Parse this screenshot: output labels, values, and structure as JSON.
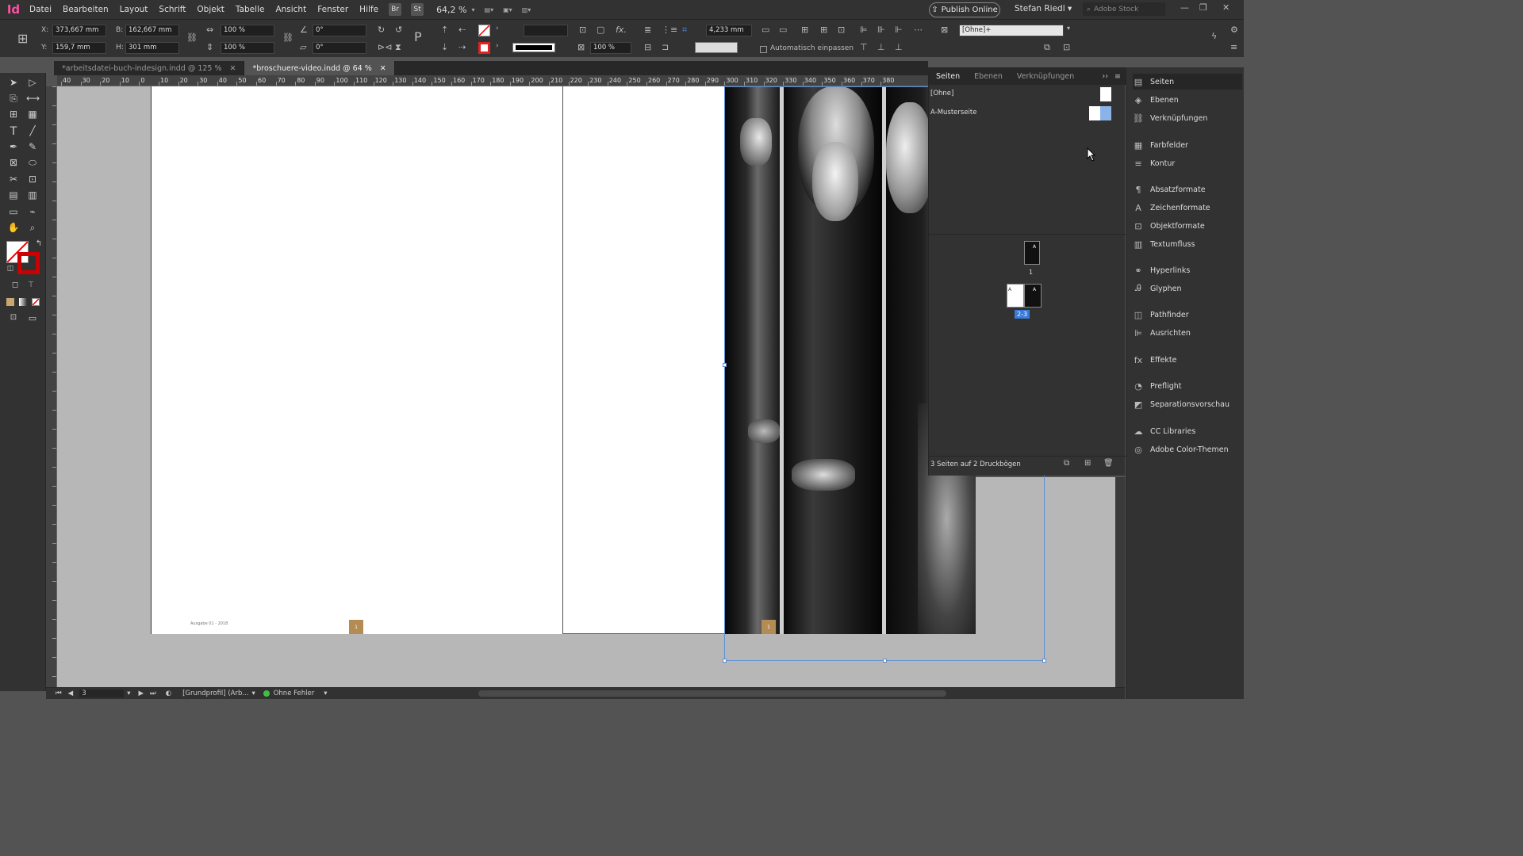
{
  "app": {
    "logo": "Id"
  },
  "menu": [
    "Datei",
    "Bearbeiten",
    "Layout",
    "Schrift",
    "Objekt",
    "Tabelle",
    "Ansicht",
    "Fenster",
    "Hilfe"
  ],
  "badges": {
    "bridge": "Br",
    "stock": "St"
  },
  "zoom": "64,2 %",
  "publish_label": "Publish Online",
  "user_name": "Stefan Riedl",
  "search_placeholder": "Adobe Stock",
  "control": {
    "x_label": "X:",
    "x_value": "373,667 mm",
    "y_label": "Y:",
    "y_value": "159,7 mm",
    "w_label": "B:",
    "w_value": "162,667 mm",
    "h_label": "H:",
    "h_value": "301 mm",
    "scale_x": "100 %",
    "scale_y": "100 %",
    "rotate": "0°",
    "shear": "0°",
    "stroke_weight": "4,233 mm",
    "opacity": "100 %",
    "object_style": "[Ohne]+",
    "autofit_label": "Automatisch einpassen"
  },
  "tabs": [
    {
      "label": "*arbeitsdatei-buch-indesign.indd @ 125 %"
    },
    {
      "label": "*broschuere-video.indd @ 64 %"
    }
  ],
  "ruler_ticks": [
    "40",
    "30",
    "20",
    "10",
    "0",
    "10",
    "20",
    "30",
    "40",
    "50",
    "60",
    "70",
    "80",
    "90",
    "100",
    "110",
    "120",
    "130",
    "140",
    "150",
    "160",
    "170",
    "180",
    "190",
    "200",
    "210",
    "220",
    "230",
    "240",
    "250",
    "260",
    "270",
    "280",
    "290",
    "300",
    "310",
    "320",
    "330",
    "340",
    "350",
    "360",
    "370",
    "380"
  ],
  "document": {
    "footer_text": "Ausgabe 01 - 2018",
    "page_number": "1"
  },
  "pages_panel": {
    "tabs": [
      "Seiten",
      "Ebenen",
      "Verknüpfungen"
    ],
    "none_label": "[Ohne]",
    "master_label": "A-Musterseite",
    "page1_label": "1",
    "spread_label": "2-3",
    "thumb_letter": "A",
    "summary": "3 Seiten auf 2 Druckbögen"
  },
  "right_panel": [
    {
      "label": "Seiten",
      "icon": "pages-icon"
    },
    {
      "label": "Ebenen",
      "icon": "layers-icon"
    },
    {
      "label": "Verknüpfungen",
      "icon": "links-icon"
    },
    {
      "label": "Farbfelder",
      "icon": "swatches-icon"
    },
    {
      "label": "Kontur",
      "icon": "stroke-icon"
    },
    {
      "label": "Absatzformate",
      "icon": "paragraph-styles-icon"
    },
    {
      "label": "Zeichenformate",
      "icon": "character-styles-icon"
    },
    {
      "label": "Objektformate",
      "icon": "object-styles-icon"
    },
    {
      "label": "Textumfluss",
      "icon": "text-wrap-icon"
    },
    {
      "label": "Hyperlinks",
      "icon": "hyperlinks-icon"
    },
    {
      "label": "Glyphen",
      "icon": "glyphs-icon"
    },
    {
      "label": "Pathfinder",
      "icon": "pathfinder-icon"
    },
    {
      "label": "Ausrichten",
      "icon": "align-icon"
    },
    {
      "label": "Effekte",
      "icon": "effects-icon"
    },
    {
      "label": "Preflight",
      "icon": "preflight-icon"
    },
    {
      "label": "Separationsvorschau",
      "icon": "separations-icon"
    },
    {
      "label": "CC Libraries",
      "icon": "cc-libraries-icon"
    },
    {
      "label": "Adobe Color-Themen",
      "icon": "color-themes-icon"
    }
  ],
  "status": {
    "page": "3",
    "profile": "[Grundprofil] (Arb...",
    "preflight": "Ohne Fehler"
  },
  "colors": {
    "accent": "#5a8fd8",
    "logo": "#ff4fa0",
    "page_marker": "#b38b55",
    "ok": "#3fbf3f"
  }
}
